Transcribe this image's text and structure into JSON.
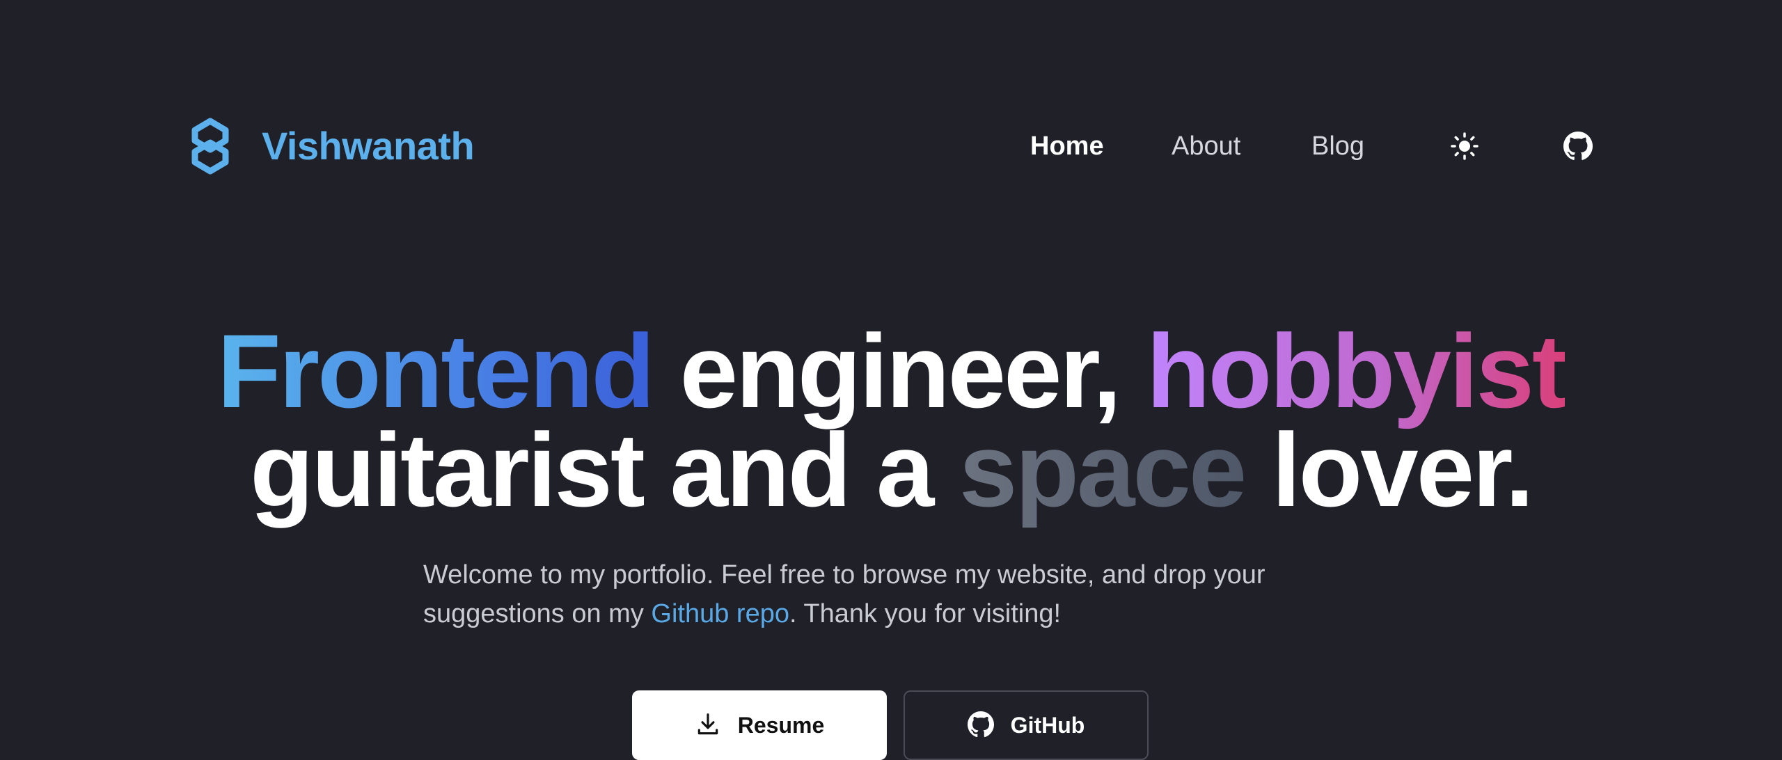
{
  "header": {
    "brand_name": "Vishwanath",
    "brand_logo_icon": "hexagon-link-logo-icon",
    "nav": {
      "home": "Home",
      "about": "About",
      "blog": "Blog"
    },
    "theme_toggle_icon": "sun-icon",
    "github_icon": "github-icon"
  },
  "hero": {
    "word_frontend": "Frontend",
    "text_engineer": " engineer, ",
    "word_hobbyist": "hobbyist",
    "text_guitarist": "guitarist and a ",
    "word_space": "space",
    "text_lover": " lover.",
    "intro_before_link": "Welcome to my portfolio. Feel free to browse my website, and drop your suggestions on my ",
    "intro_link": "Github repo",
    "intro_after_link": ". Thank you for visiting!"
  },
  "actions": {
    "resume_label": "Resume",
    "resume_icon": "download-icon",
    "github_label": "GitHub",
    "github_icon": "github-icon"
  },
  "colors": {
    "background": "#202028",
    "brand_blue": "#5cb0ec",
    "link_blue": "#5aa9e6",
    "gradient_blue": [
      "#5ab4ec",
      "#3a5fd9"
    ],
    "gradient_pink": [
      "#c084fc",
      "#d9407a"
    ],
    "gradient_gray": [
      "#6b7280",
      "#4f5868"
    ]
  }
}
